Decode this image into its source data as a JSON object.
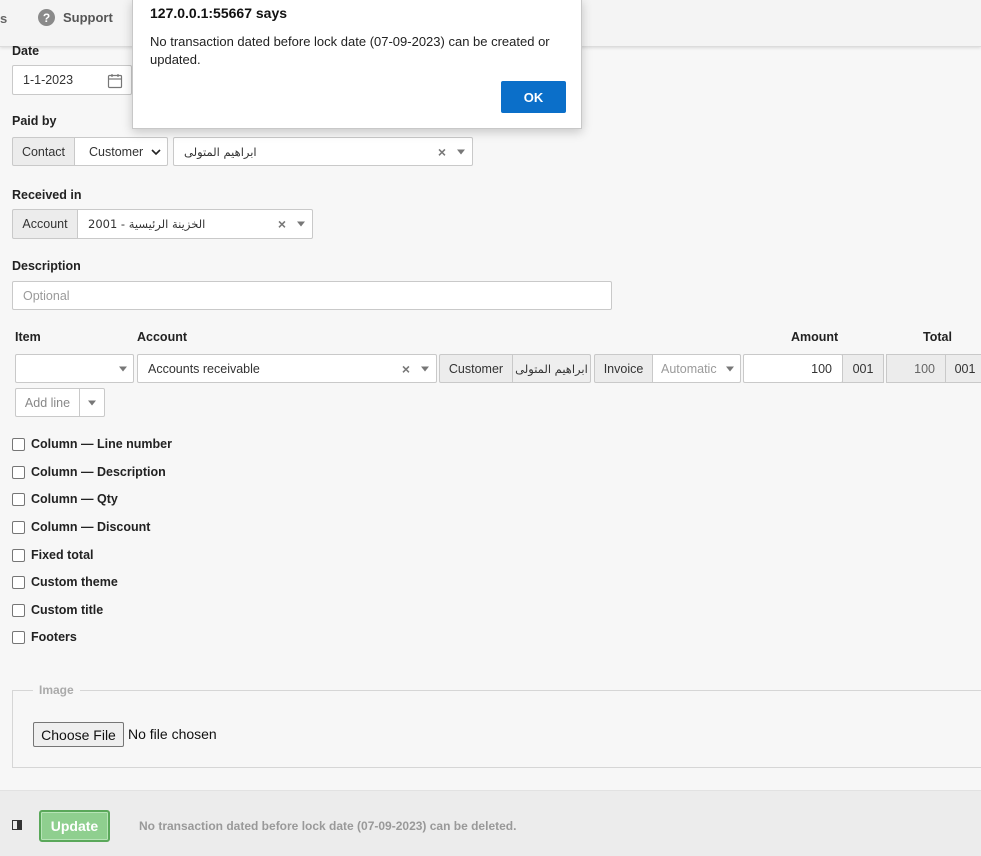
{
  "topbar": {
    "fragment_label": "s",
    "support_label": "Support",
    "support_icon": "question-circle-icon"
  },
  "form": {
    "date": {
      "label": "Date",
      "value": "1-1-2023",
      "icon": "calendar-icon"
    },
    "paid_by": {
      "label": "Paid by",
      "contact_addon": "Contact",
      "contact_type": "Customer",
      "contact_name": "ابراهيم المتولى"
    },
    "received_in": {
      "label": "Received in",
      "account_addon": "Account",
      "account_value": "الخزينة الرئيسية - 2001"
    },
    "description": {
      "label": "Description",
      "placeholder": "Optional"
    },
    "lines": {
      "headers": {
        "item": "Item",
        "account": "Account",
        "amount": "Amount",
        "total": "Total"
      },
      "row": {
        "item": "",
        "account": "Accounts receivable",
        "customer_addon": "Customer",
        "customer_name": "ابراهيم المتولى",
        "invoice_addon": "Invoice",
        "invoice_placeholder": "Automatic",
        "amount": "100",
        "amount_currency": "001",
        "total": "100",
        "total_currency": "001"
      },
      "add_line_label": "Add line"
    },
    "options": [
      "Column — Line number",
      "Column — Description",
      "Column — Qty",
      "Column — Discount",
      "Fixed total",
      "Custom theme",
      "Custom title",
      "Footers"
    ],
    "image": {
      "legend": "Image",
      "choose_file_label": "Choose File",
      "no_file_text": "No file chosen"
    }
  },
  "footer": {
    "update_label": "Update",
    "lock_message": "No transaction dated before lock date (07-09-2023) can be deleted."
  },
  "dialog": {
    "title": "127.0.0.1:55667 says",
    "message": "No transaction dated before lock date (07-09-2023) can be created or updated.",
    "ok_label": "OK"
  },
  "colors": {
    "ok_button": "#0b6fc9",
    "update_button": "#8fcf8f",
    "update_border": "#5aa85a"
  }
}
